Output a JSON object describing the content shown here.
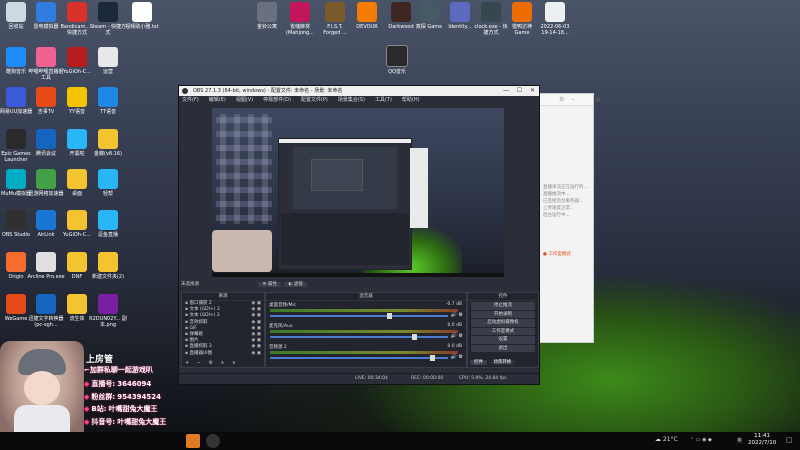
{
  "desktop": {
    "left_icons": [
      {
        "label": "回收站",
        "color": "#cfd8e3"
      },
      {
        "label": "雷电模拟器",
        "color": "#2f7de0"
      },
      {
        "label": "Bandicam... - 快捷方式",
        "color": "#d8322a"
      },
      {
        "label": "Steam - 快捷方式",
        "color": "#1b2838"
      },
      {
        "label": "视频助小雅.txt",
        "color": "#ffffff"
      },
      {
        "label": "酷狗音乐",
        "color": "#1d8cf8"
      },
      {
        "label": "哔哩哔哩直播姬工具",
        "color": "#f06292"
      },
      {
        "label": "YuGiOh-C...",
        "color": "#b71c1c"
      },
      {
        "label": "运营",
        "color": "#e8e8e8"
      },
      {
        "label": "网易UU加速器",
        "color": "#3b5bdb"
      },
      {
        "label": "吉事TV",
        "color": "#e64a19"
      },
      {
        "label": "YY语音",
        "color": "#f5c400"
      },
      {
        "label": "TT语音",
        "color": "#1e88e5"
      },
      {
        "label": "Epic Games Launcher",
        "color": "#2a2a2a"
      },
      {
        "label": "腾讯会议",
        "color": "#1565c0"
      },
      {
        "label": "开黑啦",
        "color": "#29b6f6"
      },
      {
        "label": "金蝶(v8.16)",
        "color": "#f4c430"
      },
      {
        "label": "MuMu模拟器",
        "color": "#00acc1"
      },
      {
        "label": "迅游网络加速器",
        "color": "#43a047"
      },
      {
        "label": "桌面",
        "color": "#f4c430"
      },
      {
        "label": "轻帮",
        "color": "#29b6f6"
      },
      {
        "label": "OBS Studio",
        "color": "#303030"
      },
      {
        "label": "AirLink",
        "color": "#1976d2"
      },
      {
        "label": "YuGiOh-C...",
        "color": "#f4c430"
      },
      {
        "label": "逗鱼直播",
        "color": "#29b6f6"
      },
      {
        "label": "Origin",
        "color": "#f56c2d"
      },
      {
        "label": "Arcline Pro.exe",
        "color": "#e0e0e0"
      },
      {
        "label": "DNF",
        "color": "#f4c430"
      },
      {
        "label": "新建文件夹(2)",
        "color": "#f4c430"
      },
      {
        "label": "WeGame",
        "color": "#e64a19"
      },
      {
        "label": "迅捷文字转换器(pc-sgh...",
        "color": "#1565c0"
      },
      {
        "label": "流生体",
        "color": "#f4c430"
      },
      {
        "label": "R2DUN02Y... 副本.png",
        "color": "#7b1fa2"
      }
    ],
    "top_icons": [
      {
        "label": "金铃公寓",
        "color": "#6a7080"
      },
      {
        "label": "雀魂麻将(Mahjong...",
        "color": "#c2185b"
      },
      {
        "label": "F.I.S.T. Forged ...",
        "color": "#7a5a2a"
      },
      {
        "label": "DEVOUR",
        "color": "#f57c00"
      },
      {
        "label": "Darkwood",
        "color": "#3e2723"
      },
      {
        "label": "真探 Game",
        "color": "#455a64"
      },
      {
        "label": "Identity...",
        "color": "#5c6bc0"
      },
      {
        "label": "clock.exe - 快捷方式",
        "color": "#37474f"
      },
      {
        "label": "猎鸭达神 Game",
        "color": "#ef6c00"
      },
      {
        "label": "2022-06-03 19-14-18...",
        "color": "#eceff1"
      }
    ],
    "center_icon_label": "QQ音乐"
  },
  "obs": {
    "title": "OBS 27.1.3 (64-bit, windows) - 配置文件: 未命名 - 场景: 未命名",
    "menu": [
      "文件(F)",
      "编辑(E)",
      "视图(V)",
      "停靠部件(D)",
      "配置文件(P)",
      "场景集合(S)",
      "工具(T)",
      "帮助(H)"
    ],
    "no_source": "未选择源",
    "props": "属性",
    "filters": "滤镜",
    "sources_header": "来源",
    "sources": [
      "窗口捕获 2",
      "文本 (GDI+) 3",
      "文本 (GDI+) 2",
      "音效抓取",
      "GIF",
      "弹幕姬",
      "图片",
      "直播抓取 3",
      "直播器UI图"
    ],
    "mixer_header": "混音器",
    "mixer": [
      {
        "name": "桌面音频/Mic",
        "db": "-0.7 dB",
        "level": 0.66
      },
      {
        "name": "麦克风/Aux",
        "db": "0.0 dB",
        "level": 0.8
      },
      {
        "name": "音频源 2",
        "db": "0.0 dB",
        "level": 0.9
      }
    ],
    "controls_header": "控件",
    "controls": [
      "停止推流",
      "开始录制",
      "启动虚拟摄像机",
      "工作室模式",
      "设置",
      "退出"
    ],
    "bottom_tabs": [
      "控件",
      "场景转换"
    ],
    "status": {
      "live": "LIVE: 00:34:04",
      "rec": "REC: 00:00:00",
      "cpu": "CPU: 5.9%, 24.84 fps"
    }
  },
  "side_panel": {
    "lines": [
      "直播串流正在运行的...",
      "直播推流中...",
      "已连接后台服务器...",
      "上传速度正常...",
      "后台运行中..."
    ],
    "link": "工作室模式"
  },
  "overlay": {
    "title": "上房管",
    "slogan": "加群私聊一起游戏叭",
    "lines": [
      {
        "label": "直播号:",
        "value": "3646094"
      },
      {
        "label": "粉丝群:",
        "value": "954394524"
      },
      {
        "label": "B站:",
        "value": "叶嘴甜兔大魔王"
      },
      {
        "label": "抖音号:",
        "value": "叶嘴甜兔大魔王"
      }
    ]
  },
  "taskbar": {
    "weather": "21°C",
    "time": "11:41",
    "date": "2022/7/10",
    "lang": "英"
  }
}
